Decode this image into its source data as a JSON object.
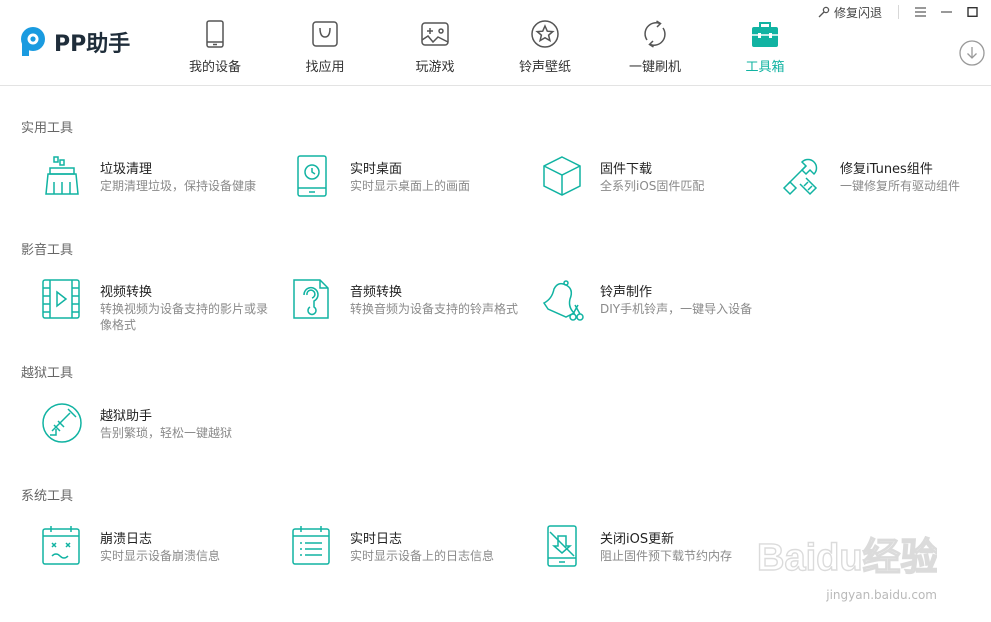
{
  "app": {
    "name": "PP助手",
    "brand_color": "#11b3a2",
    "accent_color": "#1a9be0"
  },
  "window": {
    "repair_label": "修复闪退",
    "controls": [
      "menu-icon",
      "minimize-icon",
      "maximize-icon"
    ]
  },
  "nav": {
    "items": [
      {
        "label": "我的设备",
        "icon": "phone-icon",
        "active": false
      },
      {
        "label": "找应用",
        "icon": "app-store-icon",
        "active": false
      },
      {
        "label": "玩游戏",
        "icon": "gamepad-icon",
        "active": false
      },
      {
        "label": "铃声壁纸",
        "icon": "star-circle-icon",
        "active": false
      },
      {
        "label": "一键刷机",
        "icon": "refresh-icon",
        "active": false
      },
      {
        "label": "工具箱",
        "icon": "toolbox-icon",
        "active": true
      }
    ]
  },
  "sections": [
    {
      "title": "实用工具",
      "tools": [
        {
          "name": "垃圾清理",
          "desc": "定期清理垃圾，保持设备健康",
          "icon": "broom-icon"
        },
        {
          "name": "实时桌面",
          "desc": "实时显示桌面上的画面",
          "icon": "phone-clock-icon"
        },
        {
          "name": "固件下载",
          "desc": "全系列iOS固件匹配",
          "icon": "cube-icon"
        },
        {
          "name": "修复iTunes组件",
          "desc": "一键修复所有驱动组件",
          "icon": "wrench-icon"
        }
      ]
    },
    {
      "title": "影音工具",
      "tools": [
        {
          "name": "视频转换",
          "desc": "转换视频为设备支持的影片或录像格式",
          "icon": "film-icon"
        },
        {
          "name": "音频转换",
          "desc": "转换音频为设备支持的铃声格式",
          "icon": "audio-file-icon"
        },
        {
          "name": "铃声制作",
          "desc": "DIY手机铃声，一键导入设备",
          "icon": "bell-scissors-icon"
        }
      ]
    },
    {
      "title": "越狱工具",
      "tools": [
        {
          "name": "越狱助手",
          "desc": "告别繁琐，轻松一键越狱",
          "icon": "jailbreak-icon"
        }
      ]
    },
    {
      "title": "系统工具",
      "tools": [
        {
          "name": "崩溃日志",
          "desc": "实时显示设备崩溃信息",
          "icon": "crash-calendar-icon"
        },
        {
          "name": "实时日志",
          "desc": "实时显示设备上的日志信息",
          "icon": "log-calendar-icon"
        },
        {
          "name": "关闭iOS更新",
          "desc": "阻止固件预下载节约内存",
          "icon": "phone-block-icon"
        }
      ]
    }
  ],
  "watermark": {
    "text": "Baidu经验",
    "url": "jingyan.baidu.com"
  }
}
